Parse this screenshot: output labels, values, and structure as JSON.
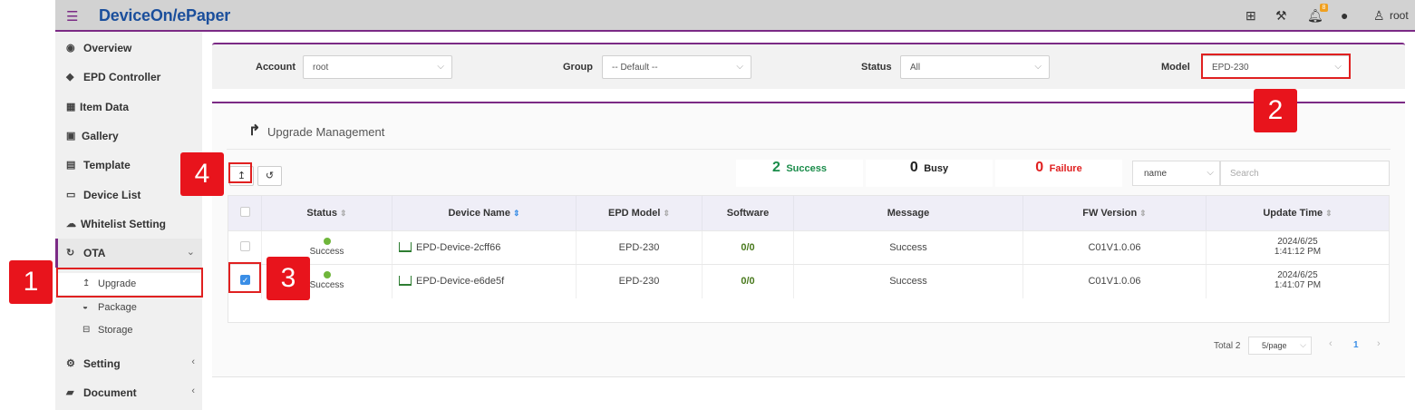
{
  "topbar": {
    "brand": "DeviceOn/ePaper",
    "user": "root",
    "notification_count": "8",
    "icons": [
      "menu-icon",
      "add-square-icon",
      "tools-icon",
      "bell-icon",
      "globe-icon",
      "user-icon"
    ]
  },
  "sidebar": {
    "items": [
      {
        "label": "Overview",
        "icon": "dashboard-icon"
      },
      {
        "label": "EPD Controller",
        "icon": "tags-icon"
      },
      {
        "label": "Item Data",
        "icon": "table-icon"
      },
      {
        "label": "Gallery",
        "icon": "image-icon"
      },
      {
        "label": "Template",
        "icon": "id-card-icon"
      },
      {
        "label": "Device List",
        "icon": "monitor-icon"
      },
      {
        "label": "Whitelist Setting",
        "icon": "cloud-icon"
      },
      {
        "label": "OTA",
        "icon": "sync-icon"
      },
      {
        "label": "Setting",
        "icon": "cogs-icon"
      },
      {
        "label": "Document",
        "icon": "book-icon"
      }
    ],
    "ota_sub": [
      {
        "label": "Upgrade",
        "icon": "upgrade-icon"
      },
      {
        "label": "Package",
        "icon": "package-icon"
      },
      {
        "label": "Storage",
        "icon": "storage-icon"
      }
    ]
  },
  "filters": {
    "account_label": "Account",
    "account_value": "root",
    "group_label": "Group",
    "group_value": "-- Default --",
    "status_label": "Status",
    "status_value": "All",
    "model_label": "Model",
    "model_value": "EPD-230"
  },
  "main": {
    "title": "Upgrade Management",
    "stats": {
      "success_count": "2",
      "success_label": "Success",
      "busy_count": "0",
      "busy_label": "Busy",
      "failure_count": "0",
      "failure_label": "Failure"
    },
    "search": {
      "field_value": "name",
      "placeholder": "Search"
    },
    "table": {
      "columns": [
        "Status",
        "Device Name",
        "EPD Model",
        "Software",
        "Message",
        "FW Version",
        "Update Time"
      ],
      "rows": [
        {
          "status": "Success",
          "device_name": "EPD-Device-2cff66",
          "epd_model": "EPD-230",
          "software": "0/0",
          "message": "Success",
          "fw_version": "C01V1.0.06",
          "update_date": "2024/6/25",
          "update_time": "1:41:12 PM",
          "checked": false
        },
        {
          "status": "Success",
          "device_name": "EPD-Device-e6de5f",
          "epd_model": "EPD-230",
          "software": "0/0",
          "message": "Success",
          "fw_version": "C01V1.0.06",
          "update_date": "2024/6/25",
          "update_time": "1:41:07 PM",
          "checked": true
        }
      ]
    },
    "pagination": {
      "total": "Total 2",
      "page_size": "5/page",
      "current_page": "1"
    }
  },
  "annotations": [
    "1",
    "2",
    "3",
    "4"
  ],
  "colors": {
    "accent": "#7b2a85",
    "brand": "#1b4f9c",
    "success": "#1a8c4a",
    "failure": "#e02020",
    "annotation": "#e8141c"
  }
}
